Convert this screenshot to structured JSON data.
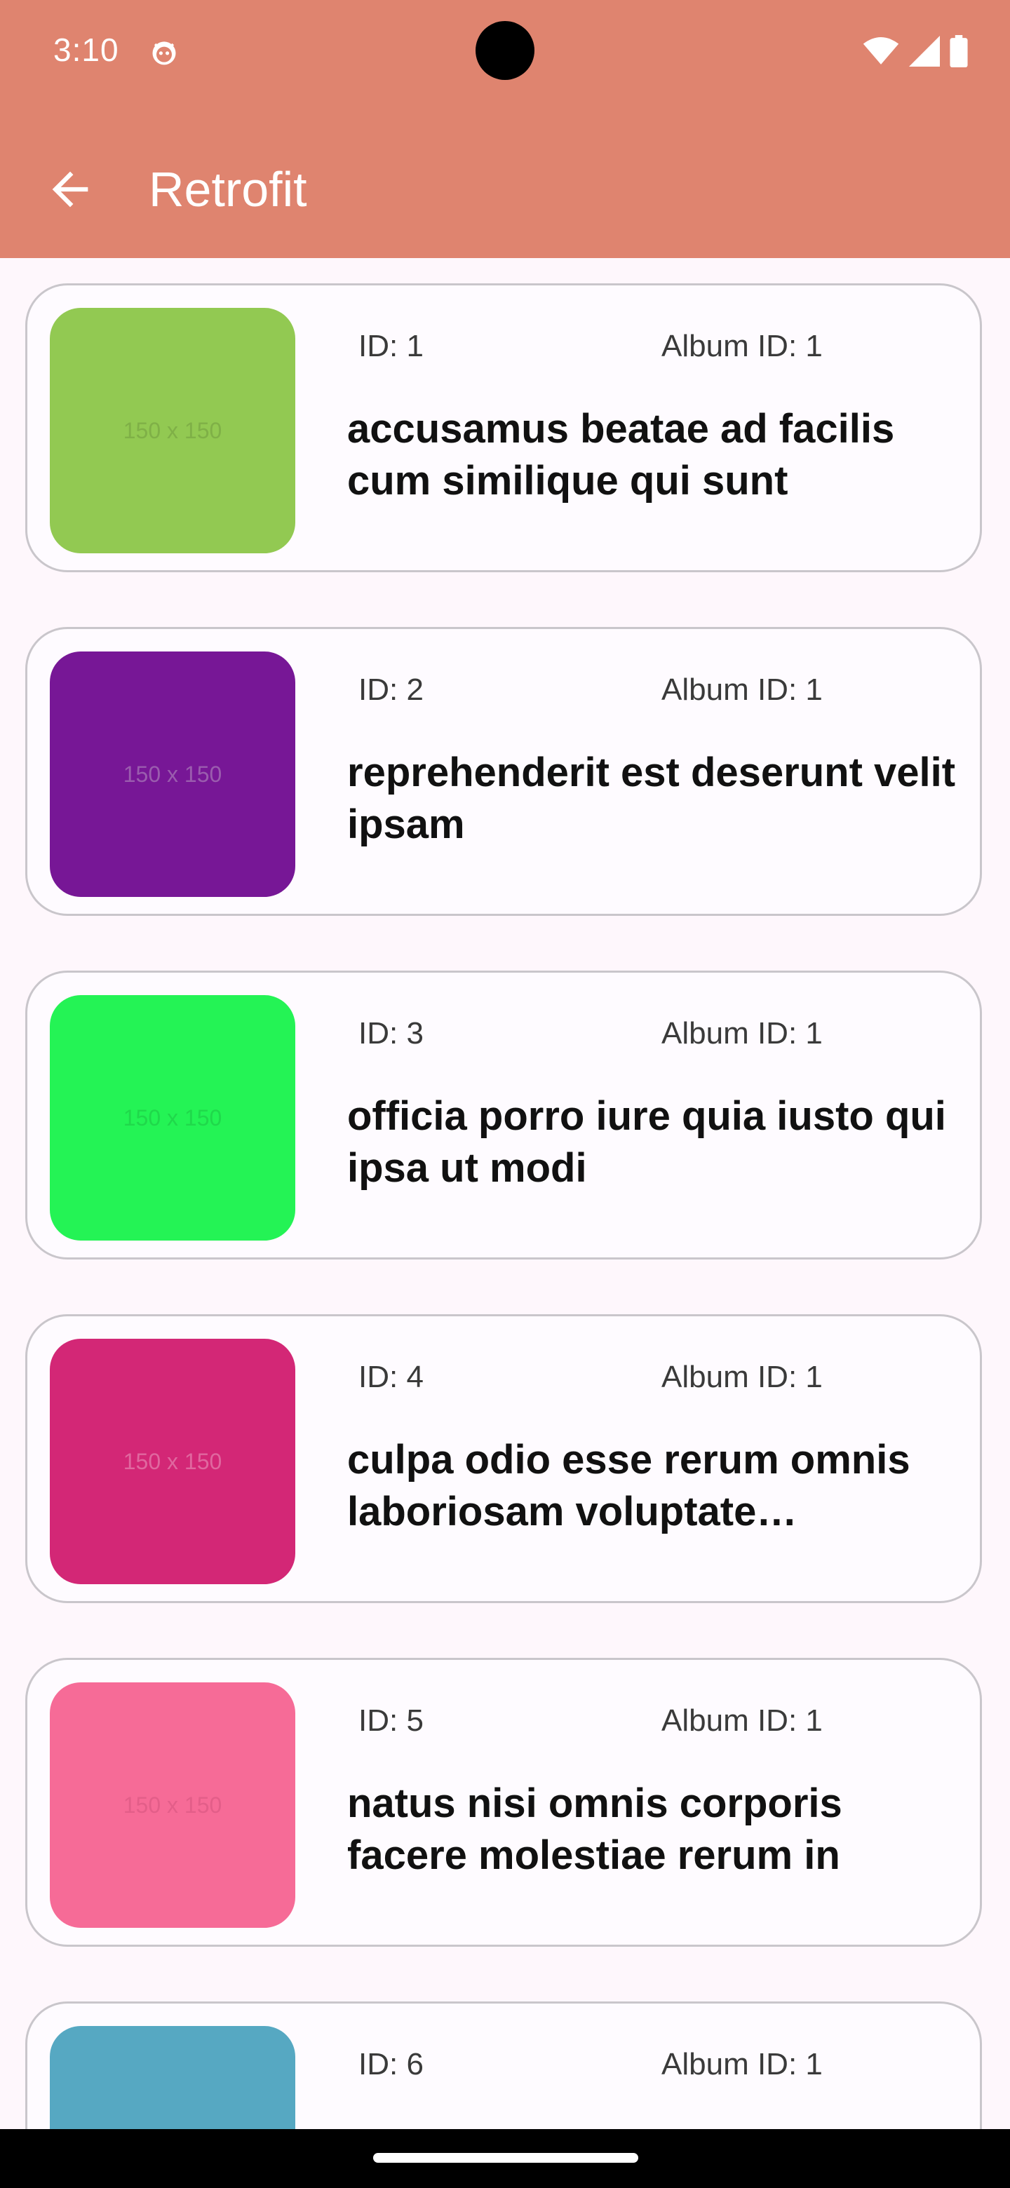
{
  "status_bar": {
    "time": "3:10"
  },
  "app_bar": {
    "title": "Retrofit"
  },
  "photos": [
    {
      "id_label": "ID: 1",
      "album_label": "Album ID: 1",
      "title": "accusamus beatae ad facilis cum similique qui sunt",
      "thumb_text": "150 x 150",
      "thumb_color": "#92c952",
      "thumb_text_color": "#7fb047"
    },
    {
      "id_label": "ID: 2",
      "album_label": "Album ID: 1",
      "title": "reprehenderit est deserunt velit ipsam",
      "thumb_text": "150 x 150",
      "thumb_color": "#771796",
      "thumb_text_color": "#9a5cae"
    },
    {
      "id_label": "ID: 3",
      "album_label": "Album ID: 1",
      "title": "officia porro iure quia iusto qui ipsa ut modi",
      "thumb_text": "150 x 150",
      "thumb_color": "#24f355",
      "thumb_text_color": "#20d84b"
    },
    {
      "id_label": "ID: 4",
      "album_label": "Album ID: 1",
      "title": "culpa odio esse rerum omnis laboriosam voluptate repudiandae",
      "thumb_text": "150 x 150",
      "thumb_color": "#d32776",
      "thumb_text_color": "#e0679f"
    },
    {
      "id_label": "ID: 5",
      "album_label": "Album ID: 1",
      "title": "natus nisi omnis corporis facere molestiae rerum in",
      "thumb_text": "150 x 150",
      "thumb_color": "#f66b97",
      "thumb_text_color": "#e35e89"
    },
    {
      "id_label": "ID: 6",
      "album_label": "Album ID: 1",
      "title": "",
      "thumb_text": "",
      "thumb_color": "#56a8c2",
      "thumb_text_color": "#56a8c2"
    }
  ]
}
